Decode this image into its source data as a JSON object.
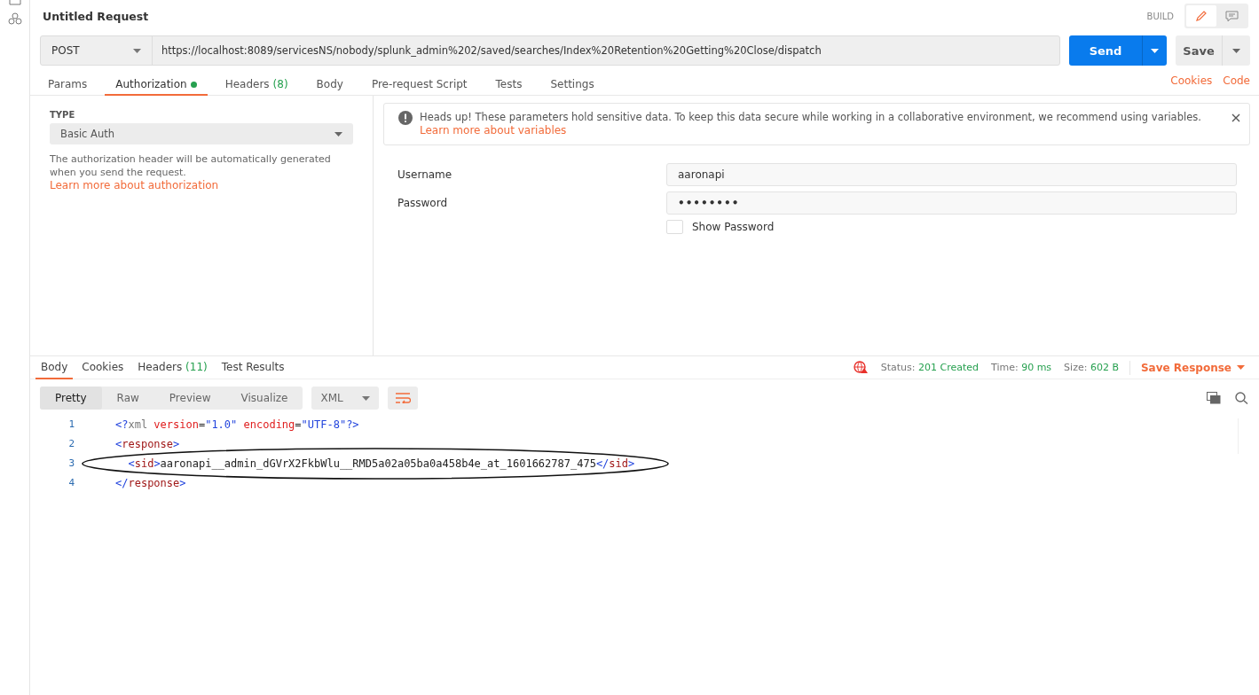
{
  "request": {
    "title": "Untitled Request",
    "mode_label": "BUILD",
    "mode_buttons": [
      {
        "kind": "edit",
        "selected": true
      },
      {
        "kind": "comments",
        "selected": false
      }
    ]
  },
  "url_bar": {
    "method": "POST",
    "url": "https://localhost:8089/servicesNS/nobody/splunk_admin%202/saved/searches/Index%20Retention%20Getting%20Close/dispatch",
    "send": "Send",
    "save": "Save"
  },
  "request_tabs": [
    {
      "label": "Params",
      "selected": false,
      "indicator": false
    },
    {
      "label": "Authorization",
      "selected": true,
      "indicator": true
    },
    {
      "label": "Headers",
      "count": "(8)",
      "selected": false,
      "indicator": false
    },
    {
      "label": "Body",
      "selected": false,
      "indicator": false
    },
    {
      "label": "Pre-request Script",
      "selected": false,
      "indicator": false
    },
    {
      "label": "Tests",
      "selected": false,
      "indicator": false
    },
    {
      "label": "Settings",
      "selected": false,
      "indicator": false
    }
  ],
  "request_links": [
    "Cookies",
    "Code"
  ],
  "auth": {
    "type_label": "TYPE",
    "type": "Basic Auth",
    "description": "The authorization header will be automatically generated when you send the request.",
    "learn_more": "Learn more about authorization"
  },
  "notice": {
    "text": "Heads up! These parameters hold sensitive data. To keep this data secure while working in a collaborative environment, we recommend using variables.",
    "link": "Learn more about variables"
  },
  "fields": [
    {
      "label": "Username",
      "value": "aaronapi",
      "kind": "text"
    },
    {
      "label": "Password",
      "value": "••••••••",
      "kind": "password"
    }
  ],
  "show_password": {
    "label": "Show Password",
    "checked": false
  },
  "response_tabs": [
    {
      "label": "Body",
      "selected": true
    },
    {
      "label": "Cookies",
      "selected": false
    },
    {
      "label": "Headers",
      "count": "(11)",
      "selected": false
    },
    {
      "label": "Test Results",
      "selected": false
    }
  ],
  "response_meta": [
    {
      "label": "Status:",
      "value": "201 Created"
    },
    {
      "label": "Time:",
      "value": "90 ms"
    },
    {
      "label": "Size:",
      "value": "602 B"
    }
  ],
  "save_response": "Save Response",
  "view_modes": [
    {
      "label": "Pretty",
      "selected": true
    },
    {
      "label": "Raw",
      "selected": false
    },
    {
      "label": "Preview",
      "selected": false
    },
    {
      "label": "Visualize",
      "selected": false
    }
  ],
  "format": "XML",
  "code_lines": [
    {
      "number": "1",
      "tokens": [
        {
          "t": "<?",
          "kind": "bracket"
        },
        {
          "t": "xml",
          "kind": "decl"
        },
        {
          "t": " version",
          "kind": "attr"
        },
        {
          "t": "=",
          "kind": "text"
        },
        {
          "t": "\"1.0\"",
          "kind": "string"
        },
        {
          "t": " encoding",
          "kind": "attr"
        },
        {
          "t": "=",
          "kind": "text"
        },
        {
          "t": "\"UTF-8\"",
          "kind": "string"
        },
        {
          "t": "?>",
          "kind": "bracket"
        }
      ]
    },
    {
      "number": "2",
      "tokens": [
        {
          "t": "<",
          "kind": "bracket"
        },
        {
          "t": "response",
          "kind": "tag"
        },
        {
          "t": ">",
          "kind": "bracket"
        }
      ]
    },
    {
      "number": "3",
      "tokens": [
        {
          "t": "  <",
          "kind": "bracket"
        },
        {
          "t": "sid",
          "kind": "tag"
        },
        {
          "t": ">",
          "kind": "bracket"
        },
        {
          "t": "aaronapi__admin_dGVrX2FkbWlu__RMD5a02a05ba0a458b4e_at_1601662787_475",
          "kind": "text"
        },
        {
          "t": "</",
          "kind": "bracket"
        },
        {
          "t": "sid",
          "kind": "tag"
        },
        {
          "t": ">",
          "kind": "bracket"
        }
      ]
    },
    {
      "number": "4",
      "tokens": [
        {
          "t": "</",
          "kind": "bracket"
        },
        {
          "t": "response",
          "kind": "tag"
        },
        {
          "t": ">",
          "kind": "bracket"
        }
      ]
    }
  ]
}
